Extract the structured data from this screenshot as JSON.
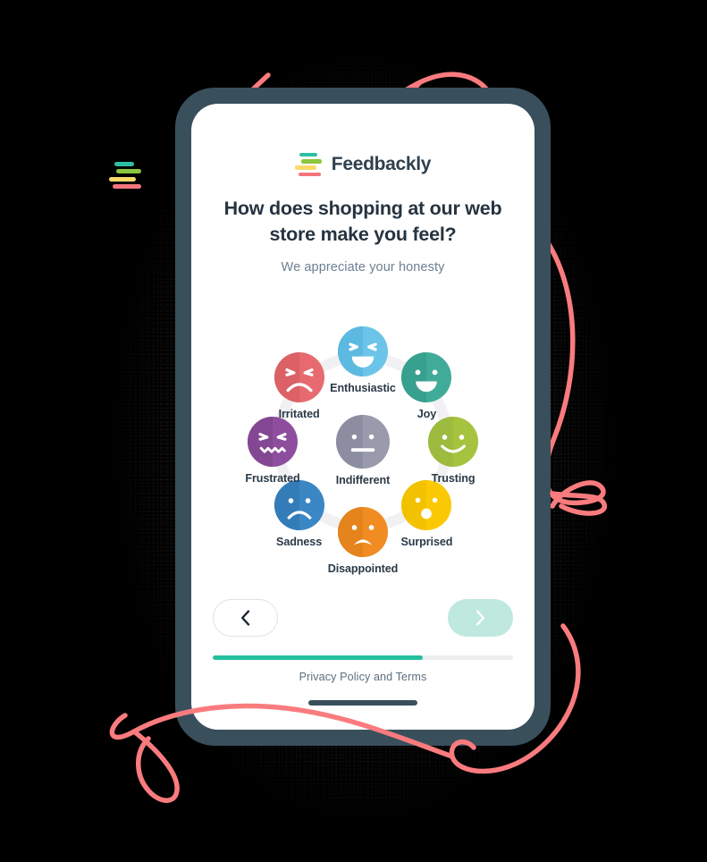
{
  "brand": {
    "name": "Feedbackly",
    "logo_bars": [
      {
        "name": "bar-teal",
        "color": "#2bbfa4"
      },
      {
        "name": "bar-green",
        "color": "#8cc63e"
      },
      {
        "name": "bar-yellow",
        "color": "#fbda6b"
      },
      {
        "name": "bar-red",
        "color": "#f4757c"
      }
    ]
  },
  "survey": {
    "question": "How does shopping at our web store make you feel?",
    "subtitle": "We appreciate your honesty",
    "options": [
      {
        "id": "enthusiastic",
        "label": "Enthusiastic",
        "color": "#6cc5e8",
        "shade": "#5cb9e0",
        "face": "squint-grin-icon",
        "angle": 90
      },
      {
        "id": "joy",
        "label": "Joy",
        "color": "#41ab9a",
        "shade": "#38a08f",
        "face": "smile-open-icon",
        "angle": 45
      },
      {
        "id": "trusting",
        "label": "Trusting",
        "color": "#a6c council",
        "shade": "#9cbb3f",
        "face": "smile-line-icon",
        "angle": 0
      },
      {
        "id": "surprised",
        "label": "Surprised",
        "color": "#fbc903",
        "shade": "#f2c200",
        "face": "surprised-o-icon",
        "angle": -45
      },
      {
        "id": "disappointed",
        "label": "Disappointed",
        "color": "#f08c22",
        "shade": "#e5831c",
        "face": "frown-open-icon",
        "angle": -90
      },
      {
        "id": "sadness",
        "label": "Sadness",
        "color": "#3b86c4",
        "shade": "#347cb8",
        "face": "frown-icon",
        "angle": -135
      },
      {
        "id": "frustrated",
        "label": "Frustrated",
        "color": "#8e4e9e",
        "shade": "#834793",
        "face": "angry-zigzag-icon",
        "angle": 180
      },
      {
        "id": "irritated",
        "label": "Irritated",
        "color": "#e66a6f",
        "shade": "#db6166",
        "face": "angry-frown-icon",
        "angle": 135
      },
      {
        "id": "indifferent",
        "label": "Indifferent",
        "color": "#9a9aad",
        "shade": "#8d8da2",
        "face": "neutral-icon",
        "angle": null
      }
    ]
  },
  "footer": {
    "back_label": "chevron-left",
    "next_label": "chevron-right",
    "privacy_text": "Privacy Policy and Terms",
    "progress_percent": 70,
    "progress_color": "#25bfa0",
    "next_button_color": "#bfe8de"
  }
}
